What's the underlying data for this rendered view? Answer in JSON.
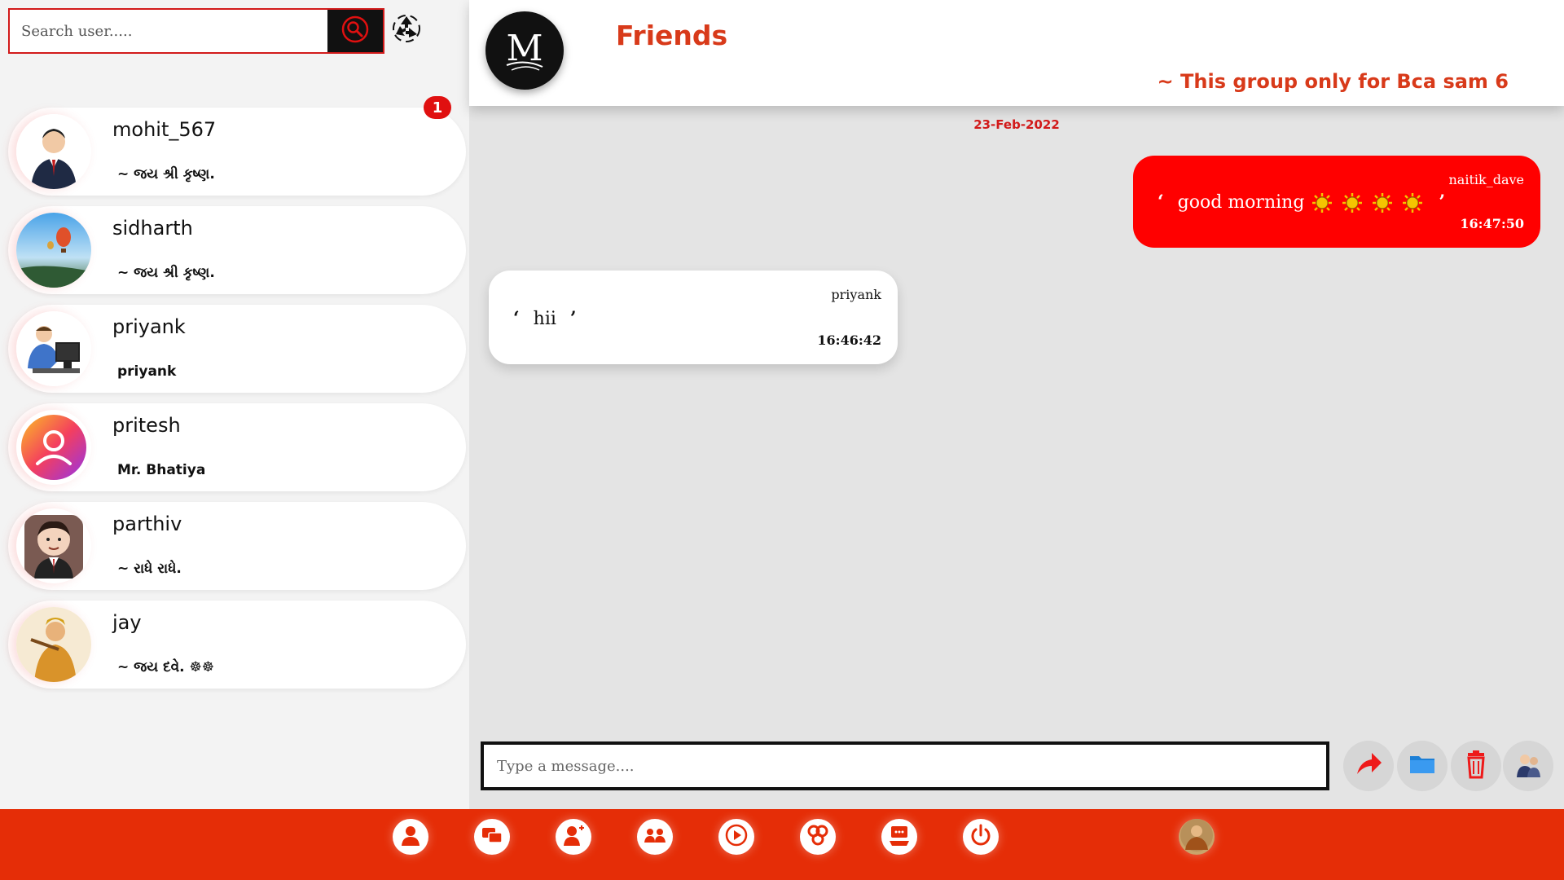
{
  "search": {
    "placeholder": "Search user....."
  },
  "users": [
    {
      "name": "mohit_567",
      "status": "~ જય શ્રી કૃષ્ણ.",
      "unread": "1"
    },
    {
      "name": "sidharth",
      "status": "~ જય શ્રી કૃષ્ણ."
    },
    {
      "name": "priyank",
      "status": "priyank"
    },
    {
      "name": "pritesh",
      "status": "Mr. Bhatiya"
    },
    {
      "name": "parthiv",
      "status": "~ રાધે રાધે."
    },
    {
      "name": "jay",
      "status": "~ જય દવે. ☸☸"
    }
  ],
  "header": {
    "logo_letter": "M",
    "title": "Friends",
    "description": "~ This group only for Bca sam 6"
  },
  "chat": {
    "date": "23-Feb-2022",
    "messages": [
      {
        "sender": "naitik_dave",
        "text": "good morning",
        "time": "16:47:50",
        "direction": "outgoing",
        "emoji": [
          "sun",
          "sun",
          "sun",
          "sun"
        ]
      },
      {
        "sender": "priyank",
        "text": "hii",
        "time": "16:46:42",
        "direction": "incoming"
      }
    ]
  },
  "composer": {
    "placeholder": "Type a message...."
  },
  "colors": {
    "accent": "#e52d07",
    "outgoing_bubble": "#ff0000",
    "title": "#d83a1a",
    "badge": "#e01010"
  },
  "icons": {
    "search": "search-icon",
    "recycle": "recycle-icon",
    "actions": [
      "send-arrow-icon",
      "folder-icon",
      "trash-icon",
      "users-icon"
    ],
    "nav": [
      "profile-icon",
      "chat-icon",
      "add-user-icon",
      "group-icon",
      "video-icon",
      "settings-icon",
      "feedback-icon",
      "power-icon",
      "user-photo"
    ]
  }
}
